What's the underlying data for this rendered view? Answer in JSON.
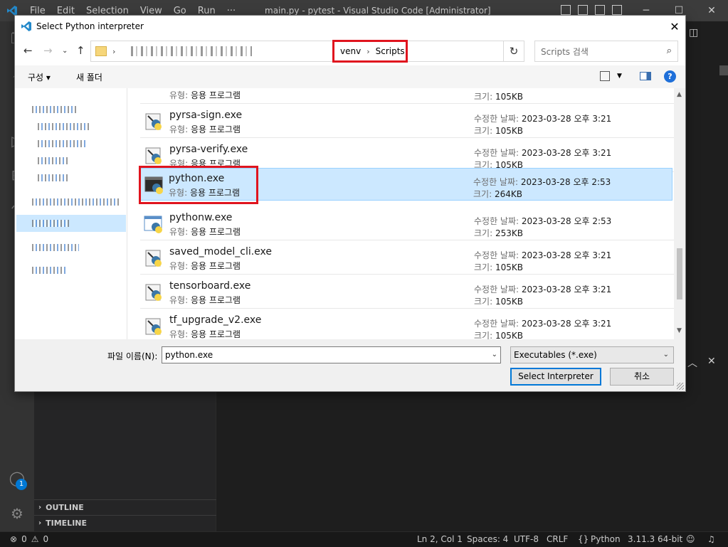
{
  "vscode": {
    "menu": [
      "File",
      "Edit",
      "Selection",
      "View",
      "Go",
      "Run",
      "···"
    ],
    "window_title": "main.py - pytest - Visual Studio Code [Administrator]",
    "badge_count": "1",
    "sidebar_sections": [
      "OUTLINE",
      "TIMELINE"
    ],
    "status": {
      "errors": "0",
      "warnings": "0",
      "position": "Ln 2, Col 1",
      "spaces": "Spaces: 4",
      "encoding": "UTF-8",
      "eol": "CRLF",
      "language": "Python",
      "interpreter": "3.11.3 64-bit"
    }
  },
  "dialog": {
    "title": "Select Python interpreter",
    "breadcrumb": [
      "venv",
      "Scripts"
    ],
    "search_placeholder": "Scripts 검색",
    "toolbar": {
      "organize": "구성 ▾",
      "new_folder": "새 폴더",
      "help": "?"
    },
    "columns": {
      "type_label": "유형:",
      "modified_label": "수정한 날짜:",
      "size_label": "크기:"
    },
    "partial_row": {
      "type": "응용 프로그램",
      "size": "105KB"
    },
    "files": [
      {
        "name": "pyrsa-sign.exe",
        "type": "응용 프로그램",
        "modified": "2023-03-28 오후 3:21",
        "size": "105KB",
        "icon": "script-exe-icon"
      },
      {
        "name": "pyrsa-verify.exe",
        "type": "응용 프로그램",
        "modified": "2023-03-28 오후 3:21",
        "size": "105KB",
        "icon": "script-exe-icon"
      },
      {
        "name": "python.exe",
        "type": "응용 프로그램",
        "modified": "2023-03-28 오후 2:53",
        "size": "264KB",
        "icon": "python-console-icon"
      },
      {
        "name": "pythonw.exe",
        "type": "응용 프로그램",
        "modified": "2023-03-28 오후 2:53",
        "size": "253KB",
        "icon": "python-window-icon"
      },
      {
        "name": "saved_model_cli.exe",
        "type": "응용 프로그램",
        "modified": "2023-03-28 오후 3:21",
        "size": "105KB",
        "icon": "script-exe-icon"
      },
      {
        "name": "tensorboard.exe",
        "type": "응용 프로그램",
        "modified": "2023-03-28 오후 3:21",
        "size": "105KB",
        "icon": "script-exe-icon"
      },
      {
        "name": "tf_upgrade_v2.exe",
        "type": "응용 프로그램",
        "modified": "2023-03-28 오후 3:21",
        "size": "105KB",
        "icon": "script-exe-icon"
      }
    ],
    "filename_label": "파일 이름(N):",
    "filename_value": "python.exe",
    "filetype_value": "Executables (*.exe)",
    "select_button": "Select Interpreter",
    "cancel_button": "취소",
    "colors": {
      "highlight": "#e0141e",
      "selection": "#cce8ff",
      "accent": "#0078d7"
    }
  }
}
